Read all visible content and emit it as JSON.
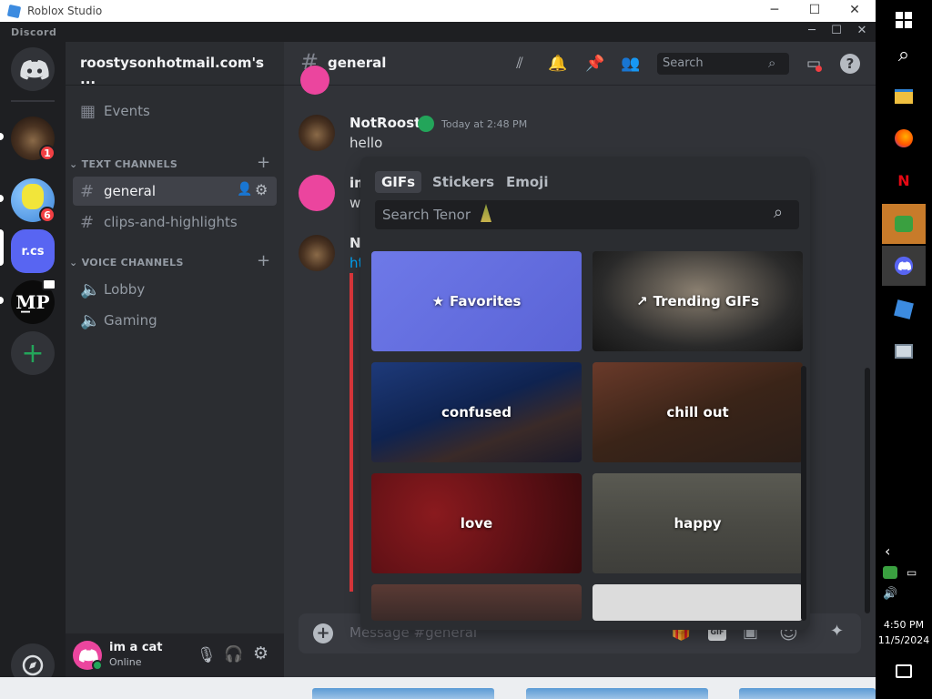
{
  "outer_window": {
    "title": "Roblox Studio"
  },
  "discord": {
    "brand": "Discord",
    "servers": [
      {
        "name": "Direct Messages"
      },
      {
        "name": "cat server",
        "badge": "1"
      },
      {
        "name": "smiley server",
        "badge": "6"
      },
      {
        "name": "r.cs",
        "label": "r.cs"
      },
      {
        "name": "MP server"
      },
      {
        "name": "Add a Server"
      },
      {
        "name": "Discover"
      }
    ],
    "server_name": "roostysonhotmail.com's ...",
    "events_label": "Events",
    "text_category": "TEXT CHANNELS",
    "text_channels": [
      "general",
      "clips-and-highlights"
    ],
    "voice_category": "VOICE CHANNELS",
    "voice_channels": [
      "Lobby",
      "Gaming"
    ],
    "user": {
      "name": "im a cat",
      "status": "Online"
    },
    "channel_header": {
      "name": "general",
      "search_placeholder": "Search"
    },
    "messages": [
      {
        "author": "NotRoosti",
        "time": "Today at 2:48 PM",
        "text": "hello"
      },
      {
        "author": "im",
        "text": "w"
      },
      {
        "author": "N",
        "text": "ht"
      }
    ],
    "composer_placeholder": "Message #general",
    "gif_button": "GIF",
    "picker": {
      "tabs": [
        "GIFs",
        "Stickers",
        "Emoji"
      ],
      "search_placeholder": "Search Tenor",
      "tiles": [
        "Favorites",
        "Trending GIFs",
        "confused",
        "chill out",
        "love",
        "happy"
      ]
    }
  },
  "taskbar": {
    "time": "4:50 PM",
    "date": "11/5/2024"
  },
  "colors": {
    "blurple": "#5865f2",
    "green": "#23a55a",
    "red": "#f23f43",
    "bg": "#313338"
  }
}
